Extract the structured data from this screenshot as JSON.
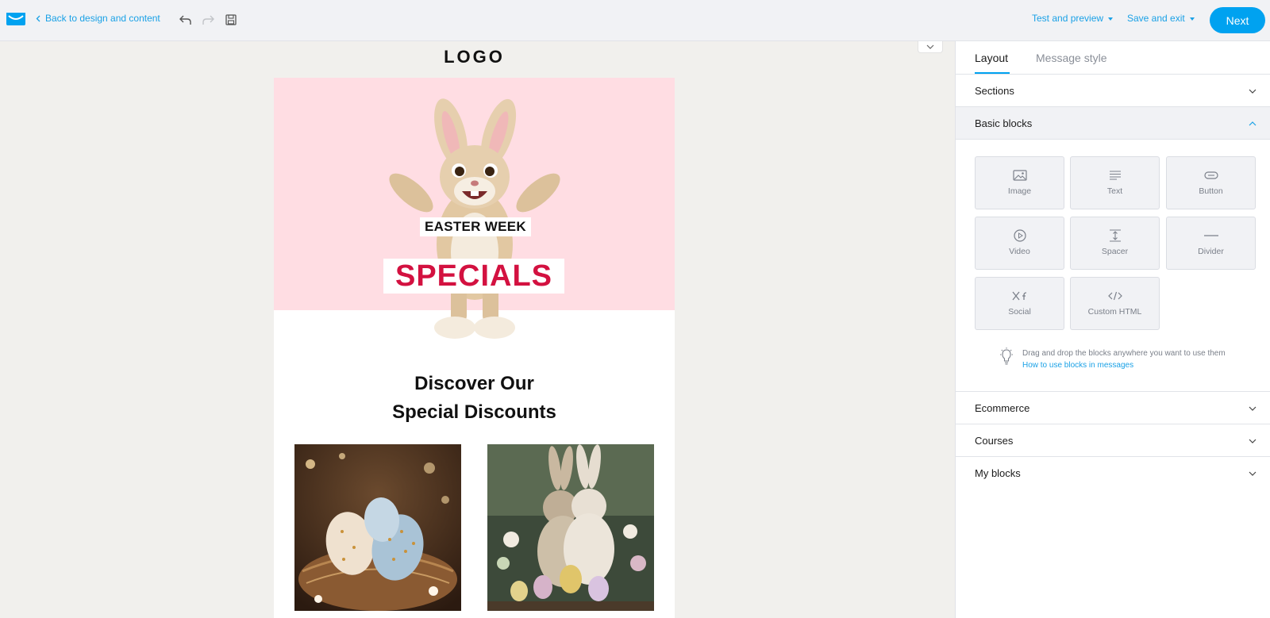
{
  "header": {
    "back_label": "Back to design and content",
    "test_preview_label": "Test and preview",
    "save_exit_label": "Save and exit",
    "next_label": "Next"
  },
  "email": {
    "logo_text": "LOGO",
    "hero_line1": "EASTER WEEK",
    "hero_line2": "SPECIALS",
    "heading_line1": "Discover Our",
    "heading_line2": "Special Discounts"
  },
  "panel": {
    "tabs": [
      {
        "label": "Layout",
        "active": true
      },
      {
        "label": "Message style",
        "active": false
      }
    ],
    "sections_label": "Sections",
    "basic_blocks_label": "Basic blocks",
    "blocks": [
      {
        "label": "Image",
        "icon": "image-icon"
      },
      {
        "label": "Text",
        "icon": "text-icon"
      },
      {
        "label": "Button",
        "icon": "button-icon"
      },
      {
        "label": "Video",
        "icon": "video-icon"
      },
      {
        "label": "Spacer",
        "icon": "spacer-icon"
      },
      {
        "label": "Divider",
        "icon": "divider-icon"
      },
      {
        "label": "Social",
        "icon": "social-icon"
      },
      {
        "label": "Custom HTML",
        "icon": "code-icon"
      }
    ],
    "tip_text": "Drag and drop the blocks anywhere you want to use them",
    "tip_link": "How to use blocks in messages",
    "ecommerce_label": "Ecommerce",
    "courses_label": "Courses",
    "my_blocks_label": "My blocks"
  },
  "colors": {
    "accent": "#00a2f0",
    "link": "#1aa1e6",
    "hero_bg": "#ffdde3",
    "specials_red": "#d31140"
  }
}
